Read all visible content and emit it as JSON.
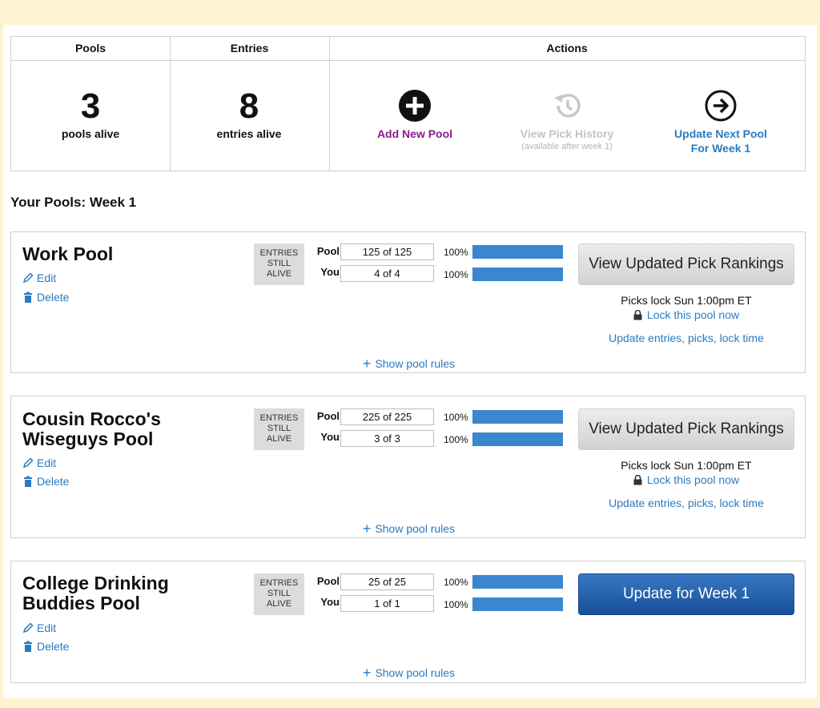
{
  "summary": {
    "pools_header": "Pools",
    "entries_header": "Entries",
    "actions_header": "Actions",
    "pools_count": "3",
    "pools_label": "pools alive",
    "entries_count": "8",
    "entries_label": "entries alive",
    "actions": {
      "add_pool": "Add New Pool",
      "view_history": "View Pick History",
      "view_history_sub": "(available after week 1)",
      "update_next_line1": "Update Next Pool",
      "update_next_line2": "For Week 1"
    }
  },
  "section_title": "Your Pools: Week 1",
  "common": {
    "edit": "Edit",
    "delete": "Delete",
    "entries_still_alive": [
      "ENTRIES",
      "STILL",
      "ALIVE"
    ],
    "pool_label": "Pool",
    "you_label": "You",
    "show_rules": "Show pool rules",
    "lock_now": "Lock this pool now",
    "update_entries": "Update entries, picks, lock time"
  },
  "pools": [
    {
      "name_line1": "Work Pool",
      "name_line2": "",
      "pool_count": "125 of 125",
      "pool_pct": "100%",
      "pool_fill": 1.0,
      "you_count": "4 of 4",
      "you_pct": "100%",
      "you_fill": 1.0,
      "button": "View Updated Pick Rankings",
      "locks": "Picks lock Sun 1:00pm ET"
    },
    {
      "name_line1": "Cousin Rocco's",
      "name_line2": "Wiseguys Pool",
      "pool_count": "225 of 225",
      "pool_pct": "100%",
      "pool_fill": 1.0,
      "you_count": "3 of 3",
      "you_pct": "100%",
      "you_fill": 1.0,
      "button": "View Updated Pick Rankings",
      "locks": "Picks lock Sun 1:00pm ET"
    },
    {
      "name_line1": "College Drinking",
      "name_line2": "Buddies Pool",
      "pool_count": "25 of 25",
      "pool_pct": "100%",
      "pool_fill": 1.0,
      "you_count": "1 of 1",
      "you_pct": "100%",
      "you_fill": 1.0,
      "button": "Update for Week 1"
    }
  ],
  "colors": {
    "link": "#2a7ac0",
    "add_pool": "#8a1a8e",
    "update_next": "#2a7ac0",
    "bar": "#3a86cf",
    "primary_button": "#1f5aa6"
  }
}
